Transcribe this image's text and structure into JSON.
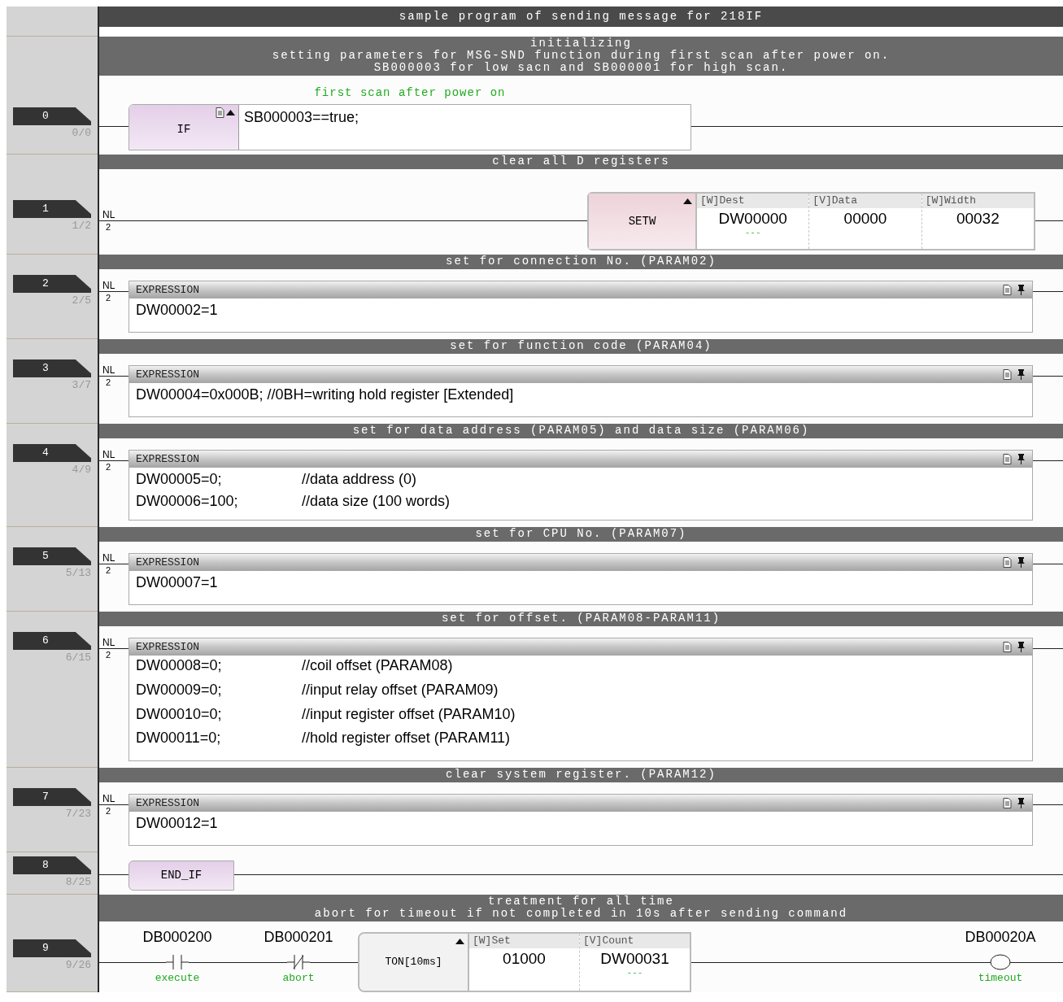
{
  "title": "sample program of sending message for 218IF",
  "rungs": [
    {
      "number": "0",
      "step": "0/0",
      "comment": [
        "initializing",
        "setting parameters for MSG-SND function during first scan after power on.",
        "SB000003 for low sacn and SB000001 for high scan."
      ],
      "kind": "if",
      "annotation": "first scan after power on",
      "instruction": "IF",
      "condition": "SB000003==true;"
    },
    {
      "number": "1",
      "step": "1/2",
      "comment": [
        "clear all D registers"
      ],
      "kind": "function_block",
      "nl": "NL",
      "nl_number": "2",
      "instruction": "SETW",
      "params": [
        {
          "label": "[W]Dest",
          "value": "DW00000",
          "note": "---"
        },
        {
          "label": "[V]Data",
          "value": "00000"
        },
        {
          "label": "[W]Width",
          "value": "00032"
        }
      ]
    },
    {
      "number": "2",
      "step": "2/5",
      "comment": [
        "set for connection No. (PARAM02)"
      ],
      "kind": "expression",
      "nl": "NL",
      "nl_number": "2",
      "header": "EXPRESSION",
      "lines": [
        {
          "code": "DW00002=1"
        }
      ]
    },
    {
      "number": "3",
      "step": "3/7",
      "comment": [
        "set for function code (PARAM04)"
      ],
      "kind": "expression",
      "nl": "NL",
      "nl_number": "2",
      "header": "EXPRESSION",
      "lines": [
        {
          "code": "DW00004=0x000B; //0BH=writing hold register [Extended]"
        }
      ]
    },
    {
      "number": "4",
      "step": "4/9",
      "comment": [
        "set for data address (PARAM05) and data size (PARAM06)"
      ],
      "kind": "expression",
      "nl": "NL",
      "nl_number": "2",
      "header": "EXPRESSION",
      "lines": [
        {
          "code": "DW00005=0;",
          "comment": "//data address (0)"
        },
        {
          "code": "DW00006=100;",
          "comment": "//data size (100 words)"
        }
      ]
    },
    {
      "number": "5",
      "step": "5/13",
      "comment": [
        "set for CPU No. (PARAM07)"
      ],
      "kind": "expression",
      "nl": "NL",
      "nl_number": "2",
      "header": "EXPRESSION",
      "lines": [
        {
          "code": "DW00007=1"
        }
      ]
    },
    {
      "number": "6",
      "step": "6/15",
      "comment": [
        "set for offset. (PARAM08-PARAM11)"
      ],
      "kind": "expression",
      "nl": "NL",
      "nl_number": "2",
      "header": "EXPRESSION",
      "lines": [
        {
          "code": "DW00008=0;",
          "comment": "//coil offset (PARAM08)"
        },
        {
          "code": "DW00009=0;",
          "comment": "//input relay offset (PARAM09)"
        },
        {
          "code": "DW00010=0;",
          "comment": "//input register offset (PARAM10)"
        },
        {
          "code": "DW00011=0;",
          "comment": "//hold register offset (PARAM11)"
        }
      ]
    },
    {
      "number": "7",
      "step": "7/23",
      "comment": [
        "clear system register. (PARAM12)"
      ],
      "kind": "expression",
      "nl": "NL",
      "nl_number": "2",
      "header": "EXPRESSION",
      "lines": [
        {
          "code": "DW00012=1"
        }
      ]
    },
    {
      "number": "8",
      "step": "8/25",
      "kind": "end_if",
      "instruction": "END_IF"
    },
    {
      "number": "9",
      "step": "9/26",
      "comment": [
        "treatment for all time",
        "abort for timeout if not completed in 10s after sending command"
      ],
      "kind": "ladder",
      "contacts": [
        {
          "kind": "no",
          "label": "DB000200",
          "note": "execute"
        },
        {
          "kind": "nc",
          "label": "DB000201",
          "note": "abort"
        }
      ],
      "block": {
        "instruction": "TON[10ms]",
        "params": [
          {
            "label": "[W]Set",
            "value": "01000"
          },
          {
            "label": "[V]Count",
            "value": "DW00031",
            "note": "---"
          }
        ]
      },
      "coil": {
        "label": "DB00020A",
        "note": "timeout"
      }
    }
  ]
}
